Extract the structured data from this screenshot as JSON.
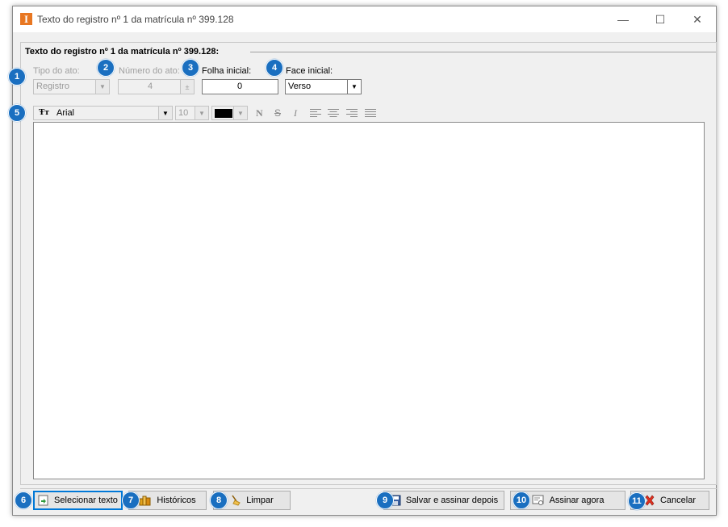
{
  "window": {
    "title": "Texto do registro nº 1 da matrícula nº 399.128",
    "app_icon_letter": "I",
    "controls": {
      "minimize": "—",
      "maximize": "☐",
      "close": "✕"
    }
  },
  "group": {
    "title": "Texto do registro nº 1 da matrícula nº 399.128:"
  },
  "fields": {
    "tipo_ato": {
      "label": "Tipo do ato:",
      "value": "Registro",
      "enabled": false
    },
    "numero_ato": {
      "label": "Número do ato:",
      "value": "4",
      "enabled": false
    },
    "folha_inicial": {
      "label": "Folha inicial:",
      "value": "0"
    },
    "face_inicial": {
      "label": "Face inicial:",
      "value": "Verso"
    }
  },
  "toolbar": {
    "font_name": "Arial",
    "font_size": "10",
    "color": "#000000",
    "bold": "N",
    "strike": "S",
    "italic": "I"
  },
  "buttons": {
    "selecionar": "Selecionar texto",
    "historicos": "Históricos",
    "limpar": "Limpar",
    "salvar": "Salvar e assinar depois",
    "assinar": "Assinar agora",
    "cancelar": "Cancelar"
  },
  "badges": [
    "1",
    "2",
    "3",
    "4",
    "5",
    "6",
    "7",
    "8",
    "9",
    "10",
    "11"
  ],
  "colors": {
    "badge": "#1a6fc0",
    "app_icon": "#e87722",
    "focus": "#0078d7"
  }
}
